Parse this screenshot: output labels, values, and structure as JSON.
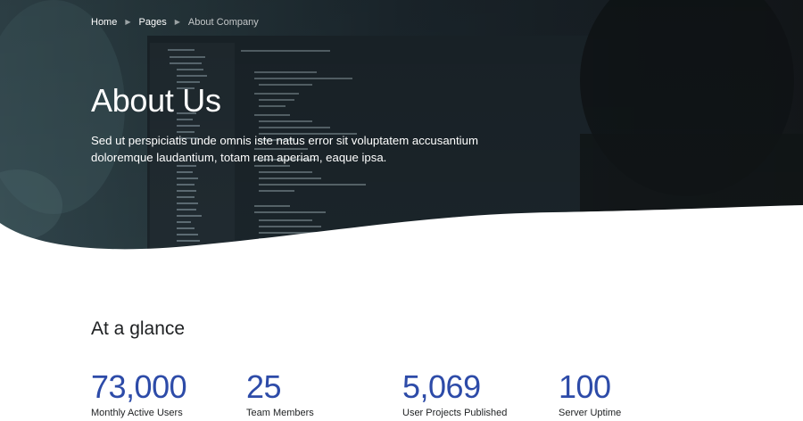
{
  "breadcrumb": {
    "items": [
      {
        "label": "Home"
      },
      {
        "label": "Pages"
      },
      {
        "label": "About Company"
      }
    ]
  },
  "hero": {
    "title": "About Us",
    "lead": "Sed ut perspiciatis unde omnis iste natus error sit voluptatem accusantium doloremque laudantium, totam rem aperiam, eaque ipsa."
  },
  "glance": {
    "title": "At a glance",
    "stats": [
      {
        "value": "73,000",
        "label": "Monthly Active Users"
      },
      {
        "value": "25",
        "label": "Team Members"
      },
      {
        "value": "5,069",
        "label": "User Projects Published"
      },
      {
        "value": "100",
        "label": "Server Uptime"
      }
    ]
  },
  "colors": {
    "accent": "#2d4ba8",
    "hero_overlay": "#1f2b33",
    "text": "#1e2022"
  }
}
